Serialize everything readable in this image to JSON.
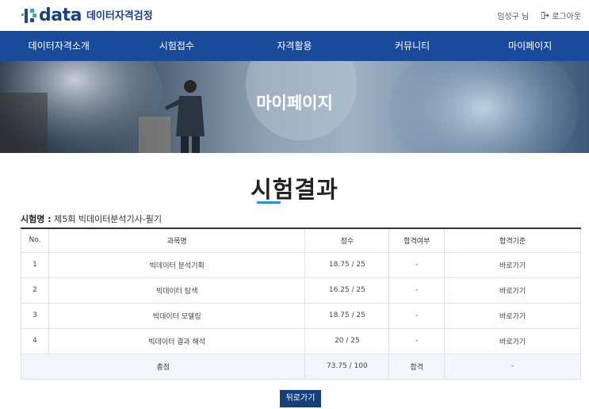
{
  "header": {
    "logo_text": "data",
    "site_title": "데이터자격검정",
    "user_name": "임성구 님",
    "logout_label": "로그아웃"
  },
  "nav": {
    "items": [
      {
        "label": "데이터자격소개"
      },
      {
        "label": "시험접수"
      },
      {
        "label": "자격활용"
      },
      {
        "label": "커뮤니티"
      },
      {
        "label": "마이페이지"
      }
    ]
  },
  "hero": {
    "title": "마이페이지"
  },
  "page": {
    "heading": "시험결과",
    "exam_label": "시험명 :",
    "exam_name": "제5회 빅데이터분석기사-필기"
  },
  "table": {
    "headers": [
      "No.",
      "과목명",
      "점수",
      "합격여부",
      "합격기준"
    ],
    "rows": [
      {
        "no": "1",
        "subject": "빅데이터 분석기획",
        "score": "18.75 / 25",
        "pass": "-",
        "criteria": "바로가기"
      },
      {
        "no": "2",
        "subject": "빅데이터 탐색",
        "score": "16.25 / 25",
        "pass": "-",
        "criteria": "바로가기"
      },
      {
        "no": "3",
        "subject": "빅데이터 모델링",
        "score": "18.75 / 25",
        "pass": "-",
        "criteria": "바로가기"
      },
      {
        "no": "4",
        "subject": "빅데이터 결과 해석",
        "score": "20 / 25",
        "pass": "-",
        "criteria": "바로가기"
      }
    ],
    "total": {
      "label": "총점",
      "score": "73.75 / 100",
      "pass": "합격",
      "criteria": "-"
    }
  },
  "back_button": {
    "label": "뒤로가기"
  },
  "colors": {
    "nav_bg": "#1a4a9a",
    "accent_underline": "#2c8fd8",
    "button_bg": "#173d7a"
  }
}
